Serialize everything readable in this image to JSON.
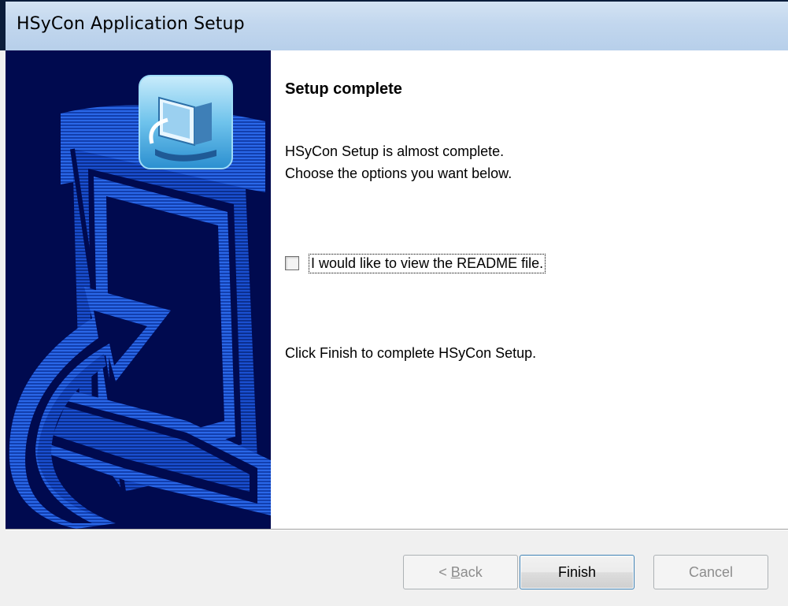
{
  "window": {
    "title": "HSyCon Application Setup"
  },
  "content": {
    "heading": "Setup complete",
    "line1": "HSyCon Setup is almost complete.",
    "line2": "Choose the options you want below.",
    "readme_checkbox": {
      "label": "I would like to view the README file.",
      "checked": false
    },
    "finish_instruction": "Click Finish to complete HSyCon Setup."
  },
  "buttons": {
    "back": {
      "prefix": "< ",
      "accel": "B",
      "rest": "ack",
      "enabled": false
    },
    "finish": {
      "label": "Finish",
      "enabled": true,
      "default": true
    },
    "cancel": {
      "label": "Cancel",
      "enabled": false
    }
  },
  "colors": {
    "side_panel_bg": "#000a4f",
    "side_panel_art": "#1f5fe0",
    "titlebar": "#c2d7ee"
  },
  "icons": {
    "installer_logo": "computer-install-icon"
  }
}
